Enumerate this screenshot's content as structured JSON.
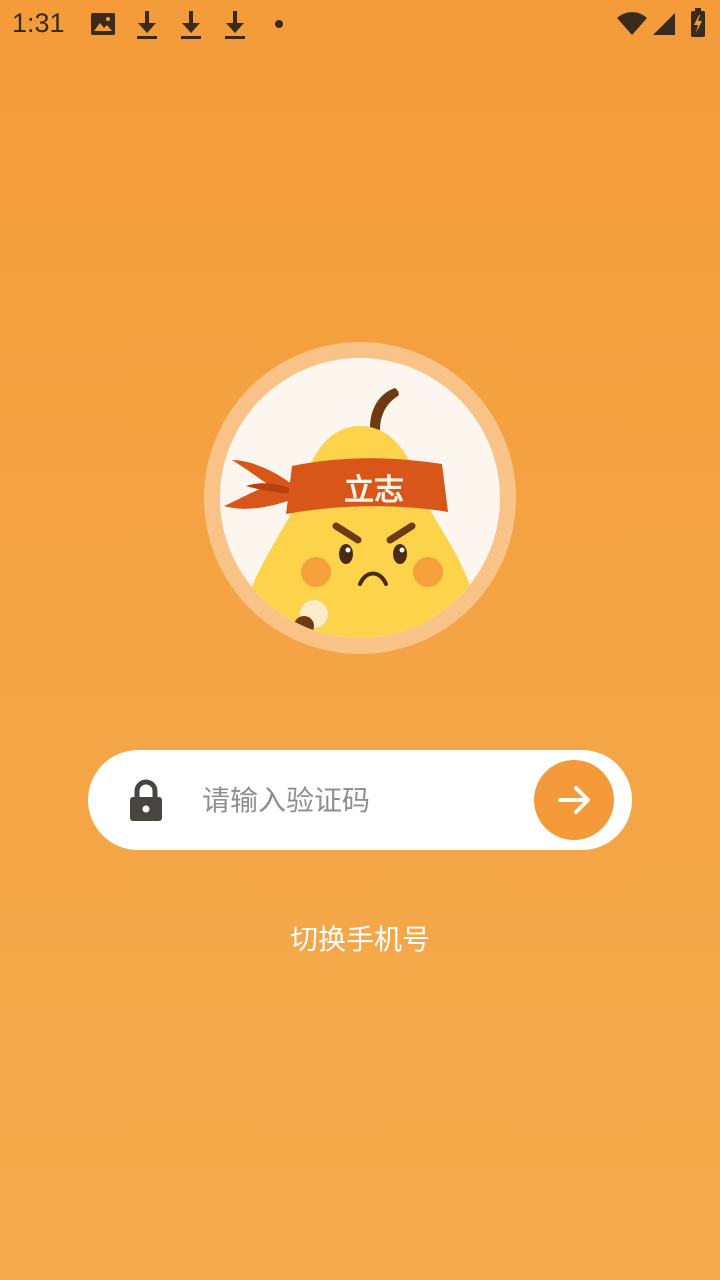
{
  "status_bar": {
    "time": "1:31",
    "icons": [
      "image-icon",
      "download-icon",
      "download-icon",
      "download-icon",
      "dot-icon",
      "wifi-icon",
      "signal-icon",
      "battery-charging-icon"
    ]
  },
  "avatar": {
    "headband_text": "立志",
    "icon": "angry-pear-mascot"
  },
  "verification": {
    "placeholder": "请输入验证码",
    "value": "",
    "lock_icon": "lock-icon",
    "submit_icon": "arrow-right-icon"
  },
  "switch_phone_label": "切换手机号",
  "colors": {
    "background_top": "#F49C3A",
    "background_bottom": "#F5AB4C",
    "accent": "#F49A3A",
    "ring": "#F9C388",
    "headband": "#D9561A"
  }
}
